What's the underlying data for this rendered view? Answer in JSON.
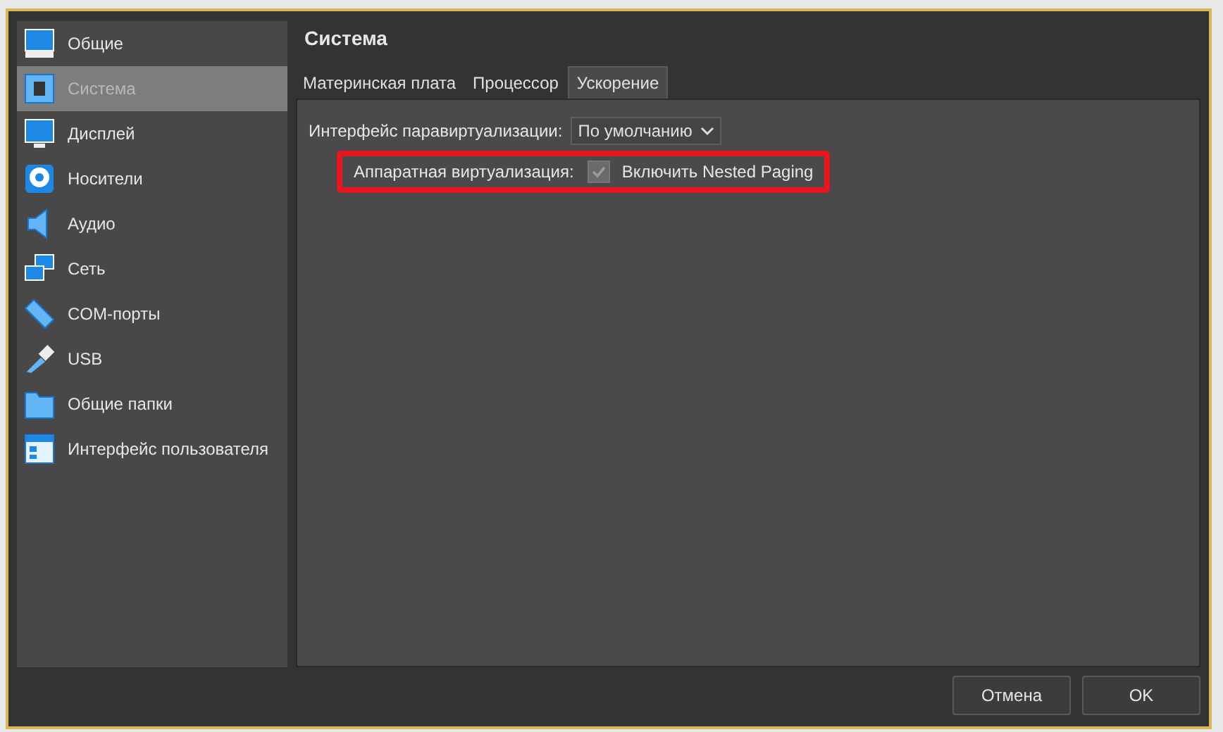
{
  "sidebar": {
    "items": [
      {
        "label": "Общие",
        "selected": false
      },
      {
        "label": "Система",
        "selected": true
      },
      {
        "label": "Дисплей",
        "selected": false
      },
      {
        "label": "Носители",
        "selected": false
      },
      {
        "label": "Аудио",
        "selected": false
      },
      {
        "label": "Сеть",
        "selected": false
      },
      {
        "label": "COM-порты",
        "selected": false
      },
      {
        "label": "USB",
        "selected": false
      },
      {
        "label": "Общие папки",
        "selected": false
      },
      {
        "label": "Интерфейс пользователя",
        "selected": false
      }
    ]
  },
  "page_title": "Система",
  "tabs": [
    {
      "label": "Материнская плата",
      "selected": false
    },
    {
      "label": "Процессор",
      "selected": false
    },
    {
      "label": "Ускорение",
      "selected": true
    }
  ],
  "paravirt": {
    "label": "Интерфейс паравиртуализации:",
    "value": "По умолчанию"
  },
  "hardware_virt": {
    "label": "Аппаратная виртуализация:",
    "checkbox": {
      "label": "Включить Nested Paging",
      "checked": true,
      "disabled": true
    },
    "highlighted": true
  },
  "buttons": [
    {
      "label": "Отмена"
    },
    {
      "label": "OK"
    }
  ]
}
